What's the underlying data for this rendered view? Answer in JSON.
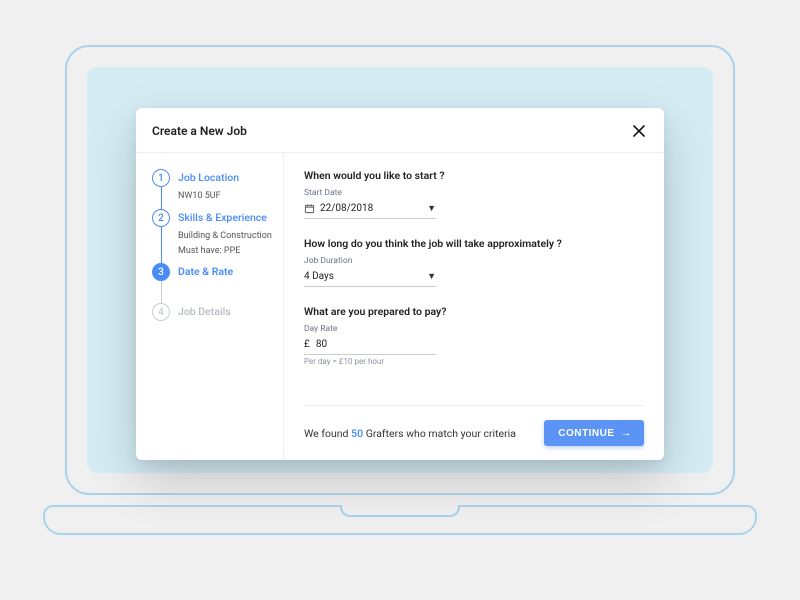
{
  "modal": {
    "title": "Create a New Job"
  },
  "stepper": {
    "steps": [
      {
        "num": "1",
        "title": "Job Location",
        "sub1": "NW10 5UF"
      },
      {
        "num": "2",
        "title": "Skills & Experience",
        "sub1": "Building & Construction",
        "sub2": "Must have: PPE"
      },
      {
        "num": "3",
        "title": "Date & Rate"
      },
      {
        "num": "4",
        "title": "Job Details"
      }
    ]
  },
  "form": {
    "start": {
      "question": "When would you like to start ?",
      "label": "Start Date",
      "value": "22/08/2018"
    },
    "duration": {
      "question": "How long do you think the job will take approximately ?",
      "label": "Job Duration",
      "value": "4 Days"
    },
    "rate": {
      "question": "What are you prepared to pay?",
      "label": "Day Rate",
      "currency": "£",
      "value": "80",
      "hint": "Per day = £10 per hour"
    }
  },
  "footer": {
    "prefix": "We found ",
    "count": "50",
    "suffix": " Grafters who match your criteria",
    "button": "CONTINUE"
  }
}
